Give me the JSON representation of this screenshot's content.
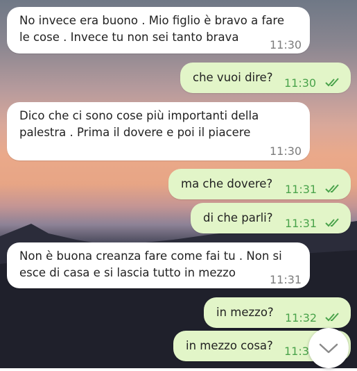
{
  "messages": [
    {
      "dir": "in",
      "lines": [
        "No invece era buono . Mio figlio è bravo a fare",
        "le cose . Invece tu non sei tanto brava"
      ],
      "time": "11:30"
    },
    {
      "dir": "out",
      "lines": [
        "che vuoi dire?"
      ],
      "time": "11:30",
      "status": "read"
    },
    {
      "dir": "in",
      "lines": [
        "Dico che ci sono cose più importanti della",
        "palestra . Prima il dovere e poi il piacere"
      ],
      "time": "11:30"
    },
    {
      "dir": "out",
      "lines": [
        "ma che dovere?"
      ],
      "time": "11:31",
      "status": "read"
    },
    {
      "dir": "out",
      "lines": [
        "di che parli?"
      ],
      "time": "11:31",
      "status": "read"
    },
    {
      "dir": "in",
      "lines": [
        "Non è buona creanza fare come fai tu . Non si",
        "esce di casa e si lascia tutto in mezzo"
      ],
      "time": "11:31"
    },
    {
      "dir": "out",
      "lines": [
        "in mezzo?"
      ],
      "time": "11:32",
      "status": "read"
    },
    {
      "dir": "out",
      "lines": [
        "in mezzo cosa?"
      ],
      "time": "11:3",
      "status": "read"
    }
  ],
  "scroll_button": {
    "icon": "chevron-down-icon"
  },
  "colors": {
    "incoming": "#ffffff",
    "outgoing": "#e2f5c8",
    "read_check": "#4aa34b"
  }
}
